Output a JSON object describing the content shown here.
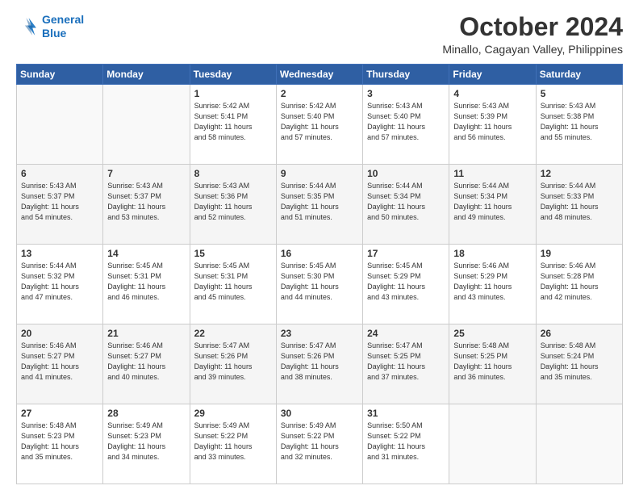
{
  "logo": {
    "line1": "General",
    "line2": "Blue"
  },
  "header": {
    "month_year": "October 2024",
    "location": "Minallo, Cagayan Valley, Philippines"
  },
  "weekdays": [
    "Sunday",
    "Monday",
    "Tuesday",
    "Wednesday",
    "Thursday",
    "Friday",
    "Saturday"
  ],
  "weeks": [
    [
      {
        "day": "",
        "info": ""
      },
      {
        "day": "",
        "info": ""
      },
      {
        "day": "1",
        "info": "Sunrise: 5:42 AM\nSunset: 5:41 PM\nDaylight: 11 hours\nand 58 minutes."
      },
      {
        "day": "2",
        "info": "Sunrise: 5:42 AM\nSunset: 5:40 PM\nDaylight: 11 hours\nand 57 minutes."
      },
      {
        "day": "3",
        "info": "Sunrise: 5:43 AM\nSunset: 5:40 PM\nDaylight: 11 hours\nand 57 minutes."
      },
      {
        "day": "4",
        "info": "Sunrise: 5:43 AM\nSunset: 5:39 PM\nDaylight: 11 hours\nand 56 minutes."
      },
      {
        "day": "5",
        "info": "Sunrise: 5:43 AM\nSunset: 5:38 PM\nDaylight: 11 hours\nand 55 minutes."
      }
    ],
    [
      {
        "day": "6",
        "info": "Sunrise: 5:43 AM\nSunset: 5:37 PM\nDaylight: 11 hours\nand 54 minutes."
      },
      {
        "day": "7",
        "info": "Sunrise: 5:43 AM\nSunset: 5:37 PM\nDaylight: 11 hours\nand 53 minutes."
      },
      {
        "day": "8",
        "info": "Sunrise: 5:43 AM\nSunset: 5:36 PM\nDaylight: 11 hours\nand 52 minutes."
      },
      {
        "day": "9",
        "info": "Sunrise: 5:44 AM\nSunset: 5:35 PM\nDaylight: 11 hours\nand 51 minutes."
      },
      {
        "day": "10",
        "info": "Sunrise: 5:44 AM\nSunset: 5:34 PM\nDaylight: 11 hours\nand 50 minutes."
      },
      {
        "day": "11",
        "info": "Sunrise: 5:44 AM\nSunset: 5:34 PM\nDaylight: 11 hours\nand 49 minutes."
      },
      {
        "day": "12",
        "info": "Sunrise: 5:44 AM\nSunset: 5:33 PM\nDaylight: 11 hours\nand 48 minutes."
      }
    ],
    [
      {
        "day": "13",
        "info": "Sunrise: 5:44 AM\nSunset: 5:32 PM\nDaylight: 11 hours\nand 47 minutes."
      },
      {
        "day": "14",
        "info": "Sunrise: 5:45 AM\nSunset: 5:31 PM\nDaylight: 11 hours\nand 46 minutes."
      },
      {
        "day": "15",
        "info": "Sunrise: 5:45 AM\nSunset: 5:31 PM\nDaylight: 11 hours\nand 45 minutes."
      },
      {
        "day": "16",
        "info": "Sunrise: 5:45 AM\nSunset: 5:30 PM\nDaylight: 11 hours\nand 44 minutes."
      },
      {
        "day": "17",
        "info": "Sunrise: 5:45 AM\nSunset: 5:29 PM\nDaylight: 11 hours\nand 43 minutes."
      },
      {
        "day": "18",
        "info": "Sunrise: 5:46 AM\nSunset: 5:29 PM\nDaylight: 11 hours\nand 43 minutes."
      },
      {
        "day": "19",
        "info": "Sunrise: 5:46 AM\nSunset: 5:28 PM\nDaylight: 11 hours\nand 42 minutes."
      }
    ],
    [
      {
        "day": "20",
        "info": "Sunrise: 5:46 AM\nSunset: 5:27 PM\nDaylight: 11 hours\nand 41 minutes."
      },
      {
        "day": "21",
        "info": "Sunrise: 5:46 AM\nSunset: 5:27 PM\nDaylight: 11 hours\nand 40 minutes."
      },
      {
        "day": "22",
        "info": "Sunrise: 5:47 AM\nSunset: 5:26 PM\nDaylight: 11 hours\nand 39 minutes."
      },
      {
        "day": "23",
        "info": "Sunrise: 5:47 AM\nSunset: 5:26 PM\nDaylight: 11 hours\nand 38 minutes."
      },
      {
        "day": "24",
        "info": "Sunrise: 5:47 AM\nSunset: 5:25 PM\nDaylight: 11 hours\nand 37 minutes."
      },
      {
        "day": "25",
        "info": "Sunrise: 5:48 AM\nSunset: 5:25 PM\nDaylight: 11 hours\nand 36 minutes."
      },
      {
        "day": "26",
        "info": "Sunrise: 5:48 AM\nSunset: 5:24 PM\nDaylight: 11 hours\nand 35 minutes."
      }
    ],
    [
      {
        "day": "27",
        "info": "Sunrise: 5:48 AM\nSunset: 5:23 PM\nDaylight: 11 hours\nand 35 minutes."
      },
      {
        "day": "28",
        "info": "Sunrise: 5:49 AM\nSunset: 5:23 PM\nDaylight: 11 hours\nand 34 minutes."
      },
      {
        "day": "29",
        "info": "Sunrise: 5:49 AM\nSunset: 5:22 PM\nDaylight: 11 hours\nand 33 minutes."
      },
      {
        "day": "30",
        "info": "Sunrise: 5:49 AM\nSunset: 5:22 PM\nDaylight: 11 hours\nand 32 minutes."
      },
      {
        "day": "31",
        "info": "Sunrise: 5:50 AM\nSunset: 5:22 PM\nDaylight: 11 hours\nand 31 minutes."
      },
      {
        "day": "",
        "info": ""
      },
      {
        "day": "",
        "info": ""
      }
    ]
  ]
}
